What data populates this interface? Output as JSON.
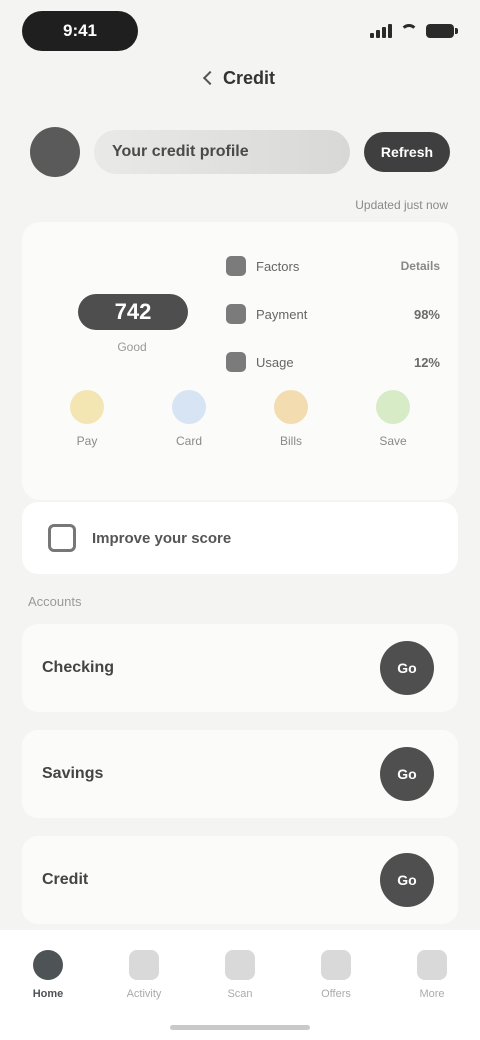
{
  "status_bar": {
    "time": "9:41"
  },
  "header": {
    "title": "Credit"
  },
  "profile": {
    "name": "Your credit profile",
    "button_label": "Refresh"
  },
  "update_caption": "Updated just now",
  "score": {
    "value": "742",
    "label": "Good",
    "categories": [
      {
        "name": "Factors",
        "value": "Details"
      },
      {
        "name": "Payment",
        "value": "98%"
      },
      {
        "name": "Usage",
        "value": "12%"
      }
    ],
    "metrics": [
      {
        "label": "Pay",
        "color": "#f3e6b2"
      },
      {
        "label": "Card",
        "color": "#d6e4f3"
      },
      {
        "label": "Bills",
        "color": "#f3dcb0"
      },
      {
        "label": "Save",
        "color": "#d7ecc6"
      }
    ]
  },
  "banner": {
    "text": "Improve your score"
  },
  "section_title": "Accounts",
  "list": [
    {
      "title": "Checking",
      "button_label": "Go"
    },
    {
      "title": "Savings",
      "button_label": "Go"
    },
    {
      "title": "Credit",
      "button_label": "Go"
    }
  ],
  "nav": [
    {
      "label": "Home"
    },
    {
      "label": "Activity"
    },
    {
      "label": "Scan"
    },
    {
      "label": "Offers"
    },
    {
      "label": "More"
    }
  ]
}
